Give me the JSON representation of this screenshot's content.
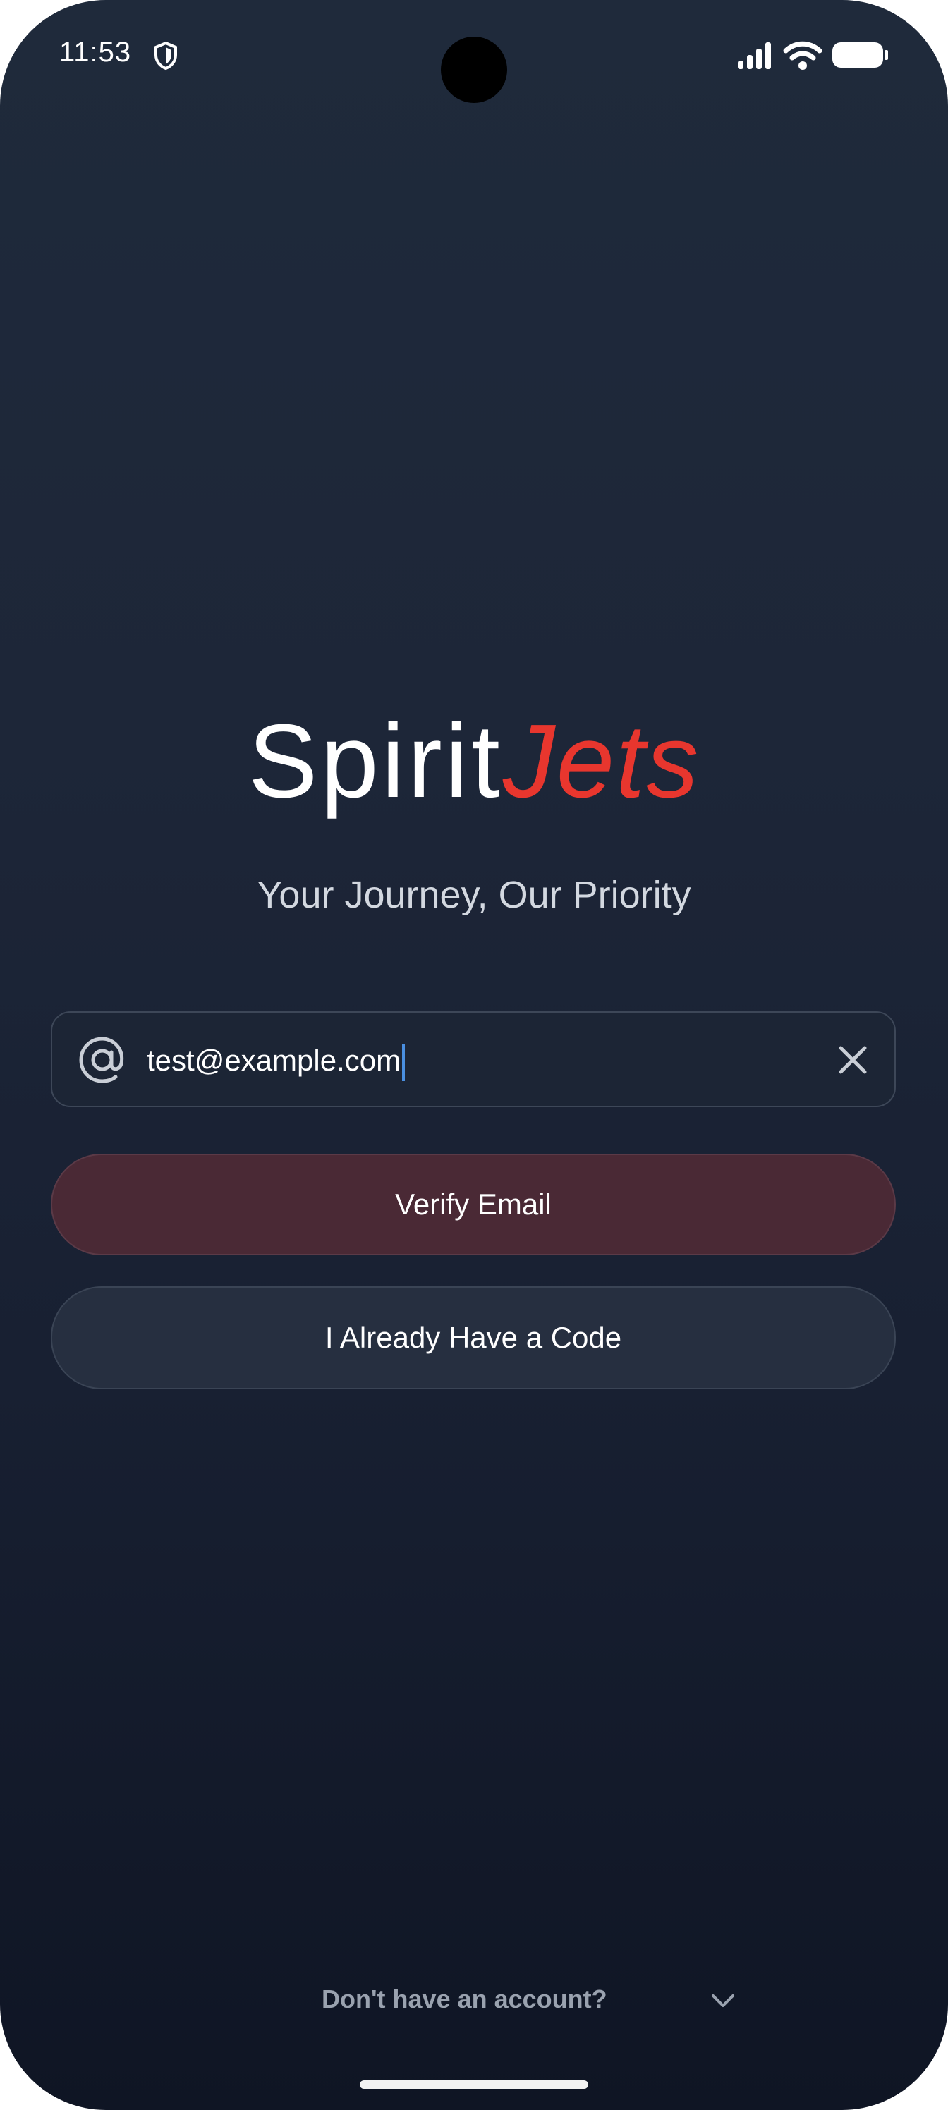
{
  "status_bar": {
    "time": "11:53",
    "icons": [
      "shield-icon",
      "signal-icon",
      "wifi-icon",
      "battery-icon"
    ]
  },
  "brand": {
    "name_part_1": "Spirit",
    "name_part_2": "Jets",
    "tagline": "Your Journey, Our Priority",
    "accent_color": "#e8362e"
  },
  "email_field": {
    "icon": "at-icon",
    "value": "test@example.com",
    "clear_icon": "close-icon"
  },
  "buttons": {
    "verify_label": "Verify Email",
    "code_label": "I Already Have a Code"
  },
  "footer": {
    "signup_prompt": "Don't have an account?",
    "expand_icon": "chevron-down-icon"
  }
}
